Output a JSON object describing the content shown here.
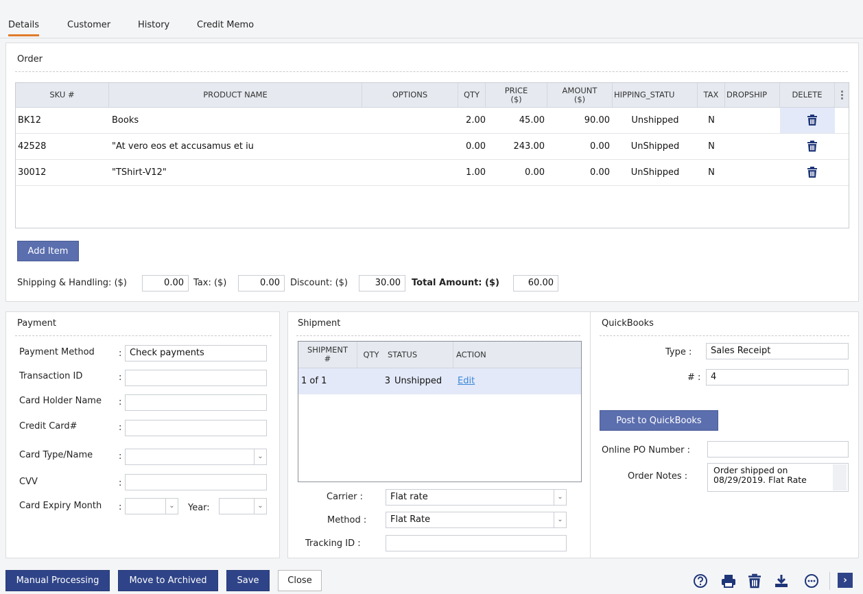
{
  "tabs": [
    "Details",
    "Customer",
    "History",
    "Credit Memo"
  ],
  "order": {
    "title": "Order",
    "columns": [
      "SKU #",
      "PRODUCT NAME",
      "OPTIONS",
      "QTY",
      "PRICE ($)",
      "AMOUNT ($)",
      "HIPPING_STATU",
      "TAX",
      "DROPSHIP",
      "DELETE"
    ],
    "rows": [
      {
        "sku": "BK12",
        "name": "Books",
        "options": "",
        "qty": "2.00",
        "price": "45.00",
        "amount": "90.00",
        "status": "Unshipped",
        "tax": "N",
        "dropship": ""
      },
      {
        "sku": "42528",
        "name": "\"At vero eos et accusamus et iu",
        "options": "",
        "qty": "0.00",
        "price": "243.00",
        "amount": "0.00",
        "status": "UnShipped",
        "tax": "N",
        "dropship": ""
      },
      {
        "sku": "30012",
        "name": "\"TShirt-V12\"",
        "options": "",
        "qty": "1.00",
        "price": "0.00",
        "amount": "0.00",
        "status": "UnShipped",
        "tax": "N",
        "dropship": ""
      }
    ],
    "add_item": "Add Item",
    "totals": {
      "shipping_label": "Shipping & Handling: ($)",
      "shipping": "0.00",
      "tax_label": "Tax: ($)",
      "tax": "0.00",
      "discount_label": "Discount: ($)",
      "discount": "30.00",
      "total_label": "Total Amount: ($)",
      "total": "60.00"
    }
  },
  "payment": {
    "title": "Payment",
    "method_label": "Payment Method",
    "method": "Check payments",
    "txn_label": "Transaction ID",
    "holder_label": "Card Holder Name",
    "card_label": "Credit Card#",
    "type_label": "Card Type/Name",
    "cvv_label": "CVV",
    "expiry_label": "Card Expiry Month",
    "year_label": "Year:",
    "colon": ":"
  },
  "shipment": {
    "title": "Shipment",
    "columns": [
      "SHIPMENT #",
      "QTY",
      "STATUS",
      "ACTION"
    ],
    "rows": [
      {
        "shipment": "1 of 1",
        "qty": "3",
        "status": "Unshipped",
        "action": "Edit"
      }
    ],
    "carrier_label": "Carrier :",
    "carrier": "Flat rate",
    "method_label": "Method :",
    "method": "Flat Rate",
    "tracking_label": "Tracking ID :",
    "tracking": ""
  },
  "quickbooks": {
    "title": "QuickBooks",
    "type_label": "Type :",
    "type": "Sales Receipt",
    "num_label": "# :",
    "num": "4",
    "post": "Post to QuickBooks",
    "po_label": "Online PO Number :",
    "po": "",
    "notes_label": "Order Notes :",
    "notes": "Order shipped  on 08/29/2019. Flat Rate"
  },
  "footer": {
    "manual": "Manual Processing",
    "archive": "Move to Archived",
    "save": "Save",
    "close": "Close"
  }
}
